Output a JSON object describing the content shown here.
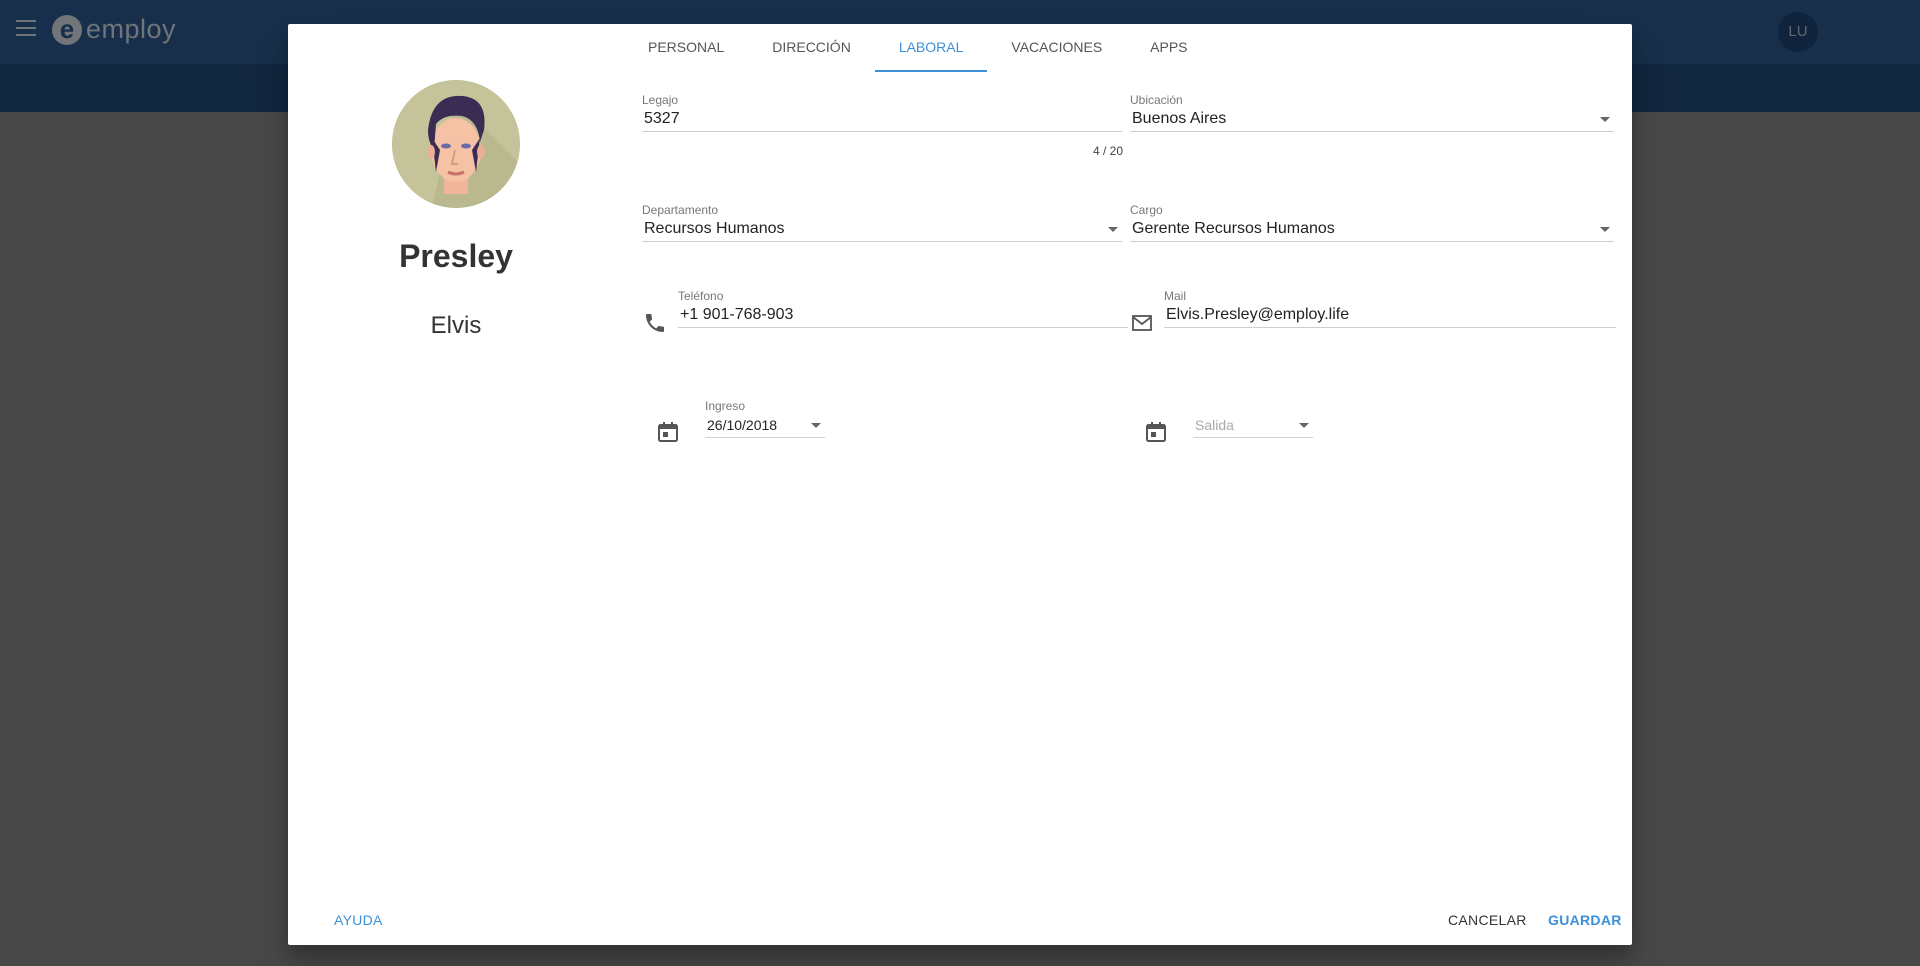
{
  "app": {
    "logo_text": "employ",
    "user_initials": "LU"
  },
  "profile": {
    "surname": "Presley",
    "first_name": "Elvis"
  },
  "tabs": [
    {
      "label": "PERSONAL"
    },
    {
      "label": "DIRECCIÓN"
    },
    {
      "label": "LABORAL",
      "active": true
    },
    {
      "label": "VACACIONES"
    },
    {
      "label": "APPS"
    }
  ],
  "form": {
    "legajo": {
      "label": "Legajo",
      "value": "5327",
      "counter": "4 / 20"
    },
    "ubicacion": {
      "label": "Ubicación",
      "value": "Buenos Aires"
    },
    "departamento": {
      "label": "Departamento",
      "value": "Recursos Humanos"
    },
    "cargo": {
      "label": "Cargo",
      "value": "Gerente Recursos Humanos"
    },
    "telefono": {
      "label": "Teléfono",
      "value": "+1 901-768-903"
    },
    "mail": {
      "label": "Mail",
      "value": "Elvis.Presley@employ.life"
    },
    "ingreso": {
      "label": "Ingreso",
      "value": "26/10/2018"
    },
    "salida": {
      "placeholder": "Salida"
    }
  },
  "footer": {
    "help": "AYUDA",
    "cancel": "CANCELAR",
    "save": "GUARDAR"
  },
  "colors": {
    "accent": "#3b90d9",
    "appbar": "#2c5a8f",
    "subbar": "#234c7c"
  },
  "icons": [
    "menu-icon",
    "phone-icon",
    "mail-icon",
    "calendar-icon",
    "chevron-down-icon"
  ]
}
